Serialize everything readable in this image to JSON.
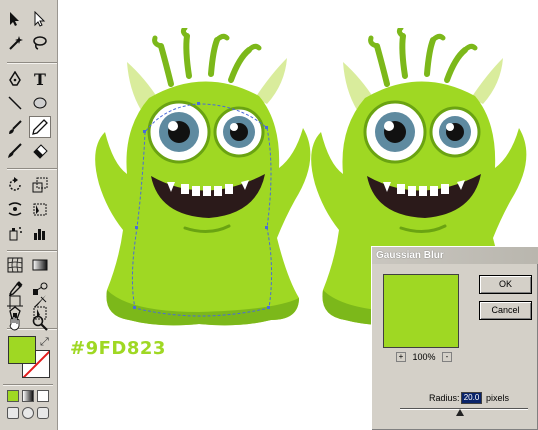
{
  "toolbar": {
    "tools": [
      {
        "name": "selection-tool-icon"
      },
      {
        "name": "direct-selection-tool-icon"
      },
      {
        "name": "magic-wand-tool-icon"
      },
      {
        "name": "lasso-tool-icon"
      },
      {
        "name": "pen-tool-icon"
      },
      {
        "name": "type-tool-icon"
      },
      {
        "name": "line-tool-icon"
      },
      {
        "name": "ellipse-tool-icon"
      },
      {
        "name": "paintbrush-tool-icon"
      },
      {
        "name": "pencil-tool-icon"
      },
      {
        "name": "blob-brush-tool-icon"
      },
      {
        "name": "eraser-tool-icon"
      },
      {
        "name": "rotate-tool-icon"
      },
      {
        "name": "scale-tool-icon"
      },
      {
        "name": "warp-tool-icon"
      },
      {
        "name": "free-transform-tool-icon"
      },
      {
        "name": "symbol-sprayer-tool-icon"
      },
      {
        "name": "column-graph-tool-icon"
      },
      {
        "name": "mesh-tool-icon"
      },
      {
        "name": "gradient-tool-icon"
      },
      {
        "name": "eyedropper-tool-icon"
      },
      {
        "name": "blend-tool-icon"
      },
      {
        "name": "live-paint-tool-icon"
      },
      {
        "name": "live-paint-selection-tool-icon"
      },
      {
        "name": "artboard-tool-icon"
      },
      {
        "name": "slice-tool-icon"
      },
      {
        "name": "hand-tool-icon"
      },
      {
        "name": "zoom-tool-icon"
      }
    ],
    "active_tool": "paintbrush-tool-icon",
    "fill_color": "#9FD823",
    "stroke_color": "none"
  },
  "canvas": {
    "hex_label": "#9FD823",
    "monster_color": "#9FD823"
  },
  "dialog": {
    "title": "Gaussian Blur",
    "ok_label": "OK",
    "cancel_label": "Cancel",
    "zoom_minus": "-",
    "zoom_plus": "+",
    "zoom_value": "100%",
    "radius_label": "Radius:",
    "radius_value": "20.0",
    "radius_unit": "pixels"
  }
}
